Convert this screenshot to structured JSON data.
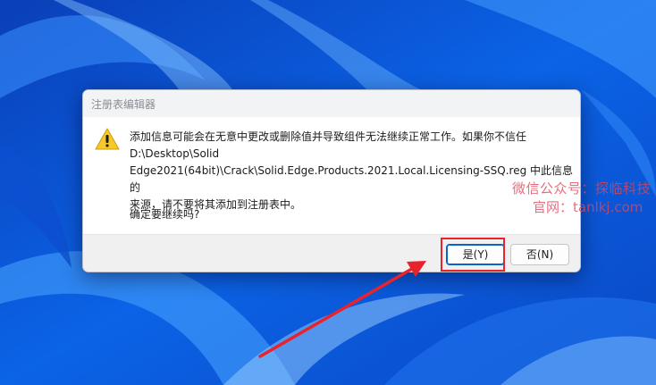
{
  "dialog": {
    "title": "注册表编辑器",
    "icon": "warning-icon",
    "message": "添加信息可能会在无意中更改或删除值并导致组件无法继续正常工作。如果你不信任\nD:\\Desktop\\Solid\nEdge2021(64bit)\\Crack\\Solid.Edge.Products.2021.Local.Licensing-SSQ.reg 中此信息的\n来源，请不要将其添加到注册表中。",
    "question": "确定要继续吗?",
    "yes_label": "是(Y)",
    "no_label": "否(N)"
  },
  "watermark": {
    "line1": "微信公众号：探临科技",
    "line2": "官网：tanlkj.com"
  },
  "colors": {
    "highlight": "#e8232b",
    "arrow": "#e8232b",
    "wallpaper": "#0a55d9"
  }
}
